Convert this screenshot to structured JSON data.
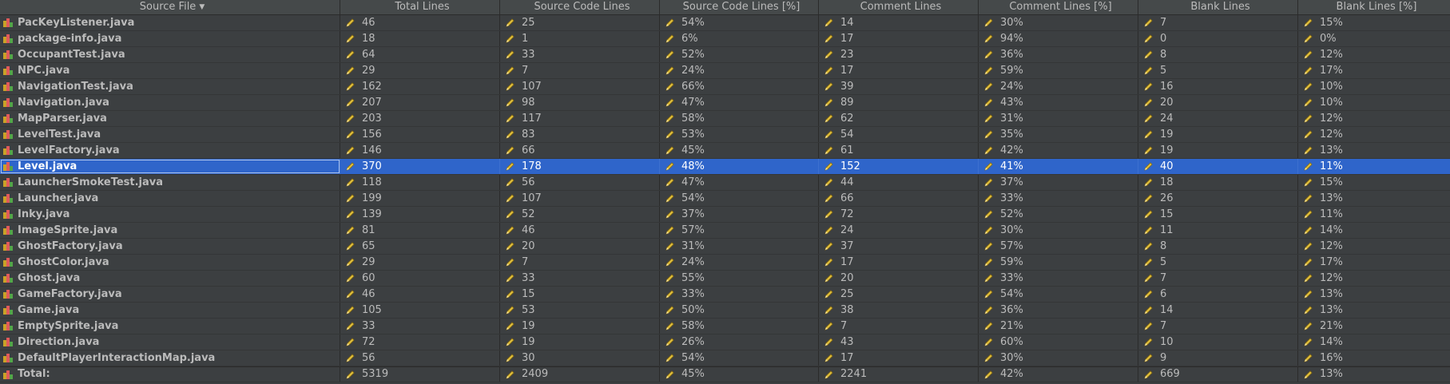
{
  "headers": [
    "Source File",
    "Total Lines",
    "Source Code Lines",
    "Source Code Lines [%]",
    "Comment Lines",
    "Comment Lines [%]",
    "Blank Lines",
    "Blank Lines [%]"
  ],
  "sort_indicator": "▼",
  "colors": {
    "selection": "#2f65ca",
    "background": "#3c3f41",
    "header": "#45494a"
  },
  "icons": {
    "file": "statistics-file-icon",
    "value": "pencil-icon"
  },
  "rows": [
    {
      "file": "PacKeyListener.java",
      "total": "46",
      "src": "25",
      "src_pct": "54%",
      "comment": "14",
      "comment_pct": "30%",
      "blank": "7",
      "blank_pct": "15%"
    },
    {
      "file": "package-info.java",
      "total": "18",
      "src": "1",
      "src_pct": "6%",
      "comment": "17",
      "comment_pct": "94%",
      "blank": "0",
      "blank_pct": "0%"
    },
    {
      "file": "OccupantTest.java",
      "total": "64",
      "src": "33",
      "src_pct": "52%",
      "comment": "23",
      "comment_pct": "36%",
      "blank": "8",
      "blank_pct": "12%"
    },
    {
      "file": "NPC.java",
      "total": "29",
      "src": "7",
      "src_pct": "24%",
      "comment": "17",
      "comment_pct": "59%",
      "blank": "5",
      "blank_pct": "17%"
    },
    {
      "file": "NavigationTest.java",
      "total": "162",
      "src": "107",
      "src_pct": "66%",
      "comment": "39",
      "comment_pct": "24%",
      "blank": "16",
      "blank_pct": "10%"
    },
    {
      "file": "Navigation.java",
      "total": "207",
      "src": "98",
      "src_pct": "47%",
      "comment": "89",
      "comment_pct": "43%",
      "blank": "20",
      "blank_pct": "10%"
    },
    {
      "file": "MapParser.java",
      "total": "203",
      "src": "117",
      "src_pct": "58%",
      "comment": "62",
      "comment_pct": "31%",
      "blank": "24",
      "blank_pct": "12%"
    },
    {
      "file": "LevelTest.java",
      "total": "156",
      "src": "83",
      "src_pct": "53%",
      "comment": "54",
      "comment_pct": "35%",
      "blank": "19",
      "blank_pct": "12%"
    },
    {
      "file": "LevelFactory.java",
      "total": "146",
      "src": "66",
      "src_pct": "45%",
      "comment": "61",
      "comment_pct": "42%",
      "blank": "19",
      "blank_pct": "13%"
    },
    {
      "file": "Level.java",
      "total": "370",
      "src": "178",
      "src_pct": "48%",
      "comment": "152",
      "comment_pct": "41%",
      "blank": "40",
      "blank_pct": "11%",
      "selected": true
    },
    {
      "file": "LauncherSmokeTest.java",
      "total": "118",
      "src": "56",
      "src_pct": "47%",
      "comment": "44",
      "comment_pct": "37%",
      "blank": "18",
      "blank_pct": "15%"
    },
    {
      "file": "Launcher.java",
      "total": "199",
      "src": "107",
      "src_pct": "54%",
      "comment": "66",
      "comment_pct": "33%",
      "blank": "26",
      "blank_pct": "13%"
    },
    {
      "file": "Inky.java",
      "total": "139",
      "src": "52",
      "src_pct": "37%",
      "comment": "72",
      "comment_pct": "52%",
      "blank": "15",
      "blank_pct": "11%"
    },
    {
      "file": "ImageSprite.java",
      "total": "81",
      "src": "46",
      "src_pct": "57%",
      "comment": "24",
      "comment_pct": "30%",
      "blank": "11",
      "blank_pct": "14%"
    },
    {
      "file": "GhostFactory.java",
      "total": "65",
      "src": "20",
      "src_pct": "31%",
      "comment": "37",
      "comment_pct": "57%",
      "blank": "8",
      "blank_pct": "12%"
    },
    {
      "file": "GhostColor.java",
      "total": "29",
      "src": "7",
      "src_pct": "24%",
      "comment": "17",
      "comment_pct": "59%",
      "blank": "5",
      "blank_pct": "17%"
    },
    {
      "file": "Ghost.java",
      "total": "60",
      "src": "33",
      "src_pct": "55%",
      "comment": "20",
      "comment_pct": "33%",
      "blank": "7",
      "blank_pct": "12%"
    },
    {
      "file": "GameFactory.java",
      "total": "46",
      "src": "15",
      "src_pct": "33%",
      "comment": "25",
      "comment_pct": "54%",
      "blank": "6",
      "blank_pct": "13%"
    },
    {
      "file": "Game.java",
      "total": "105",
      "src": "53",
      "src_pct": "50%",
      "comment": "38",
      "comment_pct": "36%",
      "blank": "14",
      "blank_pct": "13%"
    },
    {
      "file": "EmptySprite.java",
      "total": "33",
      "src": "19",
      "src_pct": "58%",
      "comment": "7",
      "comment_pct": "21%",
      "blank": "7",
      "blank_pct": "21%"
    },
    {
      "file": "Direction.java",
      "total": "72",
      "src": "19",
      "src_pct": "26%",
      "comment": "43",
      "comment_pct": "60%",
      "blank": "10",
      "blank_pct": "14%"
    },
    {
      "file": "DefaultPlayerInteractionMap.java",
      "total": "56",
      "src": "30",
      "src_pct": "54%",
      "comment": "17",
      "comment_pct": "30%",
      "blank": "9",
      "blank_pct": "16%"
    }
  ],
  "total": {
    "file": "Total:",
    "total": "5319",
    "src": "2409",
    "src_pct": "45%",
    "comment": "2241",
    "comment_pct": "42%",
    "blank": "669",
    "blank_pct": "13%"
  }
}
